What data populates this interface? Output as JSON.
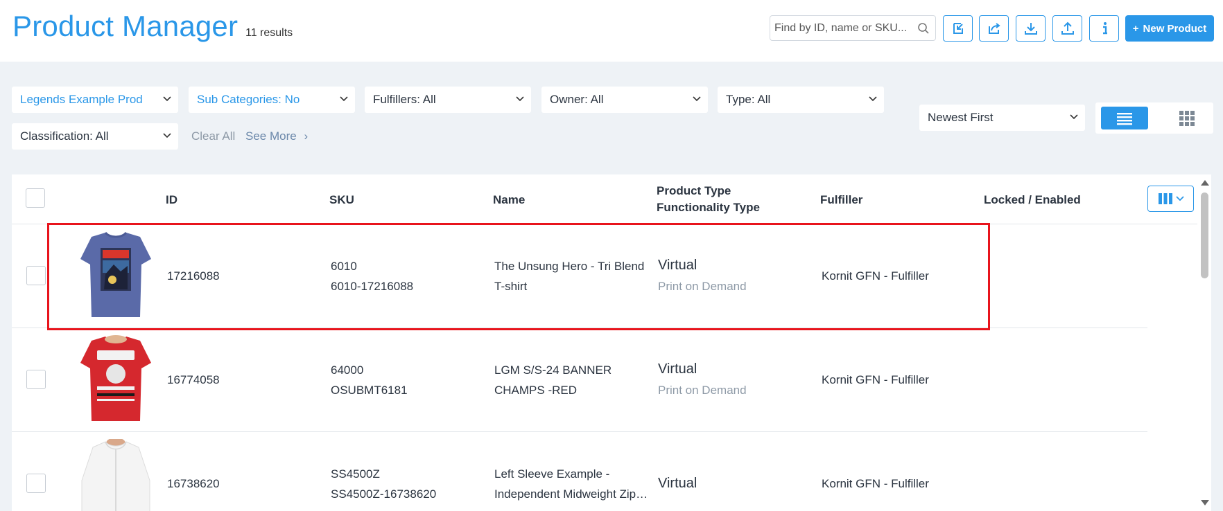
{
  "header": {
    "title": "Product Manager",
    "results": "11 results",
    "search_placeholder": "Find by ID, name or SKU...",
    "new_product_label": "New Product",
    "toolbar_icons": [
      "import-icon",
      "share-icon",
      "download-icon",
      "upload-icon",
      "info-icon"
    ]
  },
  "filters": {
    "row1": [
      "Legends Example Prod",
      "Sub Categories: No",
      "Fulfillers: All",
      "Owner: All",
      "Type: All"
    ],
    "row2": [
      "Classification: All"
    ],
    "clear_all": "Clear All",
    "see_more": "See More"
  },
  "sort": {
    "selected": "Newest First"
  },
  "table": {
    "columns": {
      "id": "ID",
      "sku": "SKU",
      "name": "Name",
      "product_type": "Product Type",
      "functionality_type": "Functionality Type",
      "fulfiller": "Fulfiller",
      "locked_enabled": "Locked / Enabled"
    },
    "rows": [
      {
        "id": "17216088",
        "sku": "6010",
        "sku2": "6010-17216088",
        "name1": "The Unsung Hero - Tri Blend",
        "name2": "T-shirt",
        "type": "Virtual",
        "functionality": "Print on Demand",
        "fulfiller": "Kornit GFN - Fulfiller"
      },
      {
        "id": "16774058",
        "sku": "64000",
        "sku2": "OSUBMT6181",
        "name1": "LGM S/S-24 BANNER",
        "name2": "CHAMPS -RED",
        "type": "Virtual",
        "functionality": "Print on Demand",
        "fulfiller": "Kornit GFN - Fulfiller"
      },
      {
        "id": "16738620",
        "sku": "SS4500Z",
        "sku2": "SS4500Z-16738620",
        "name1": "Left Sleeve Example -",
        "name2": "Independent Midweight Zip…",
        "type": "Virtual",
        "functionality": "",
        "fulfiller": "Kornit GFN - Fulfiller"
      }
    ]
  },
  "colors": {
    "accent": "#2a97e8",
    "highlight": "#e8141c",
    "muted": "#8d99a6"
  }
}
